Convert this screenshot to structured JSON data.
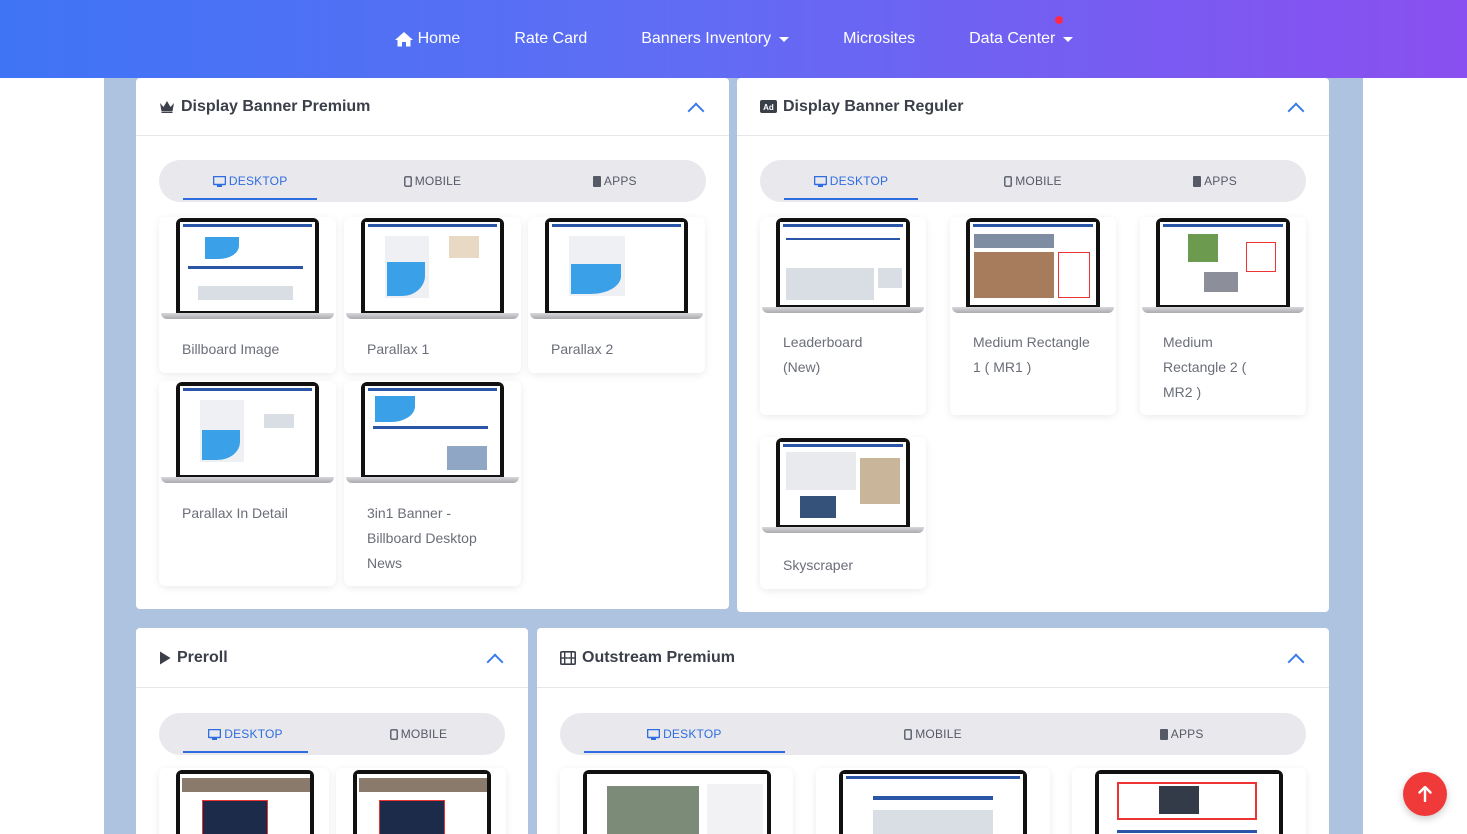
{
  "nav": {
    "home": "Home",
    "rate_card": "Rate Card",
    "banners_inventory": "Banners Inventory",
    "microsites": "Microsites",
    "data_center": "Data Center"
  },
  "tabs": {
    "desktop": "DESKTOP",
    "mobile": "MOBILE",
    "apps": "APPS"
  },
  "premium": {
    "title": "Display Banner Premium",
    "items": [
      "Billboard Image",
      "Parallax 1",
      "Parallax 2",
      "Parallax In Detail",
      "3in1 Banner - Billboard Desktop News"
    ]
  },
  "reguler": {
    "title": "Display Banner Reguler",
    "items": [
      "Leaderboard (New)",
      "Medium Rectangle 1 ( MR1 )",
      "Medium Rectangle 2 ( MR2 )",
      "Skyscraper"
    ]
  },
  "preroll": {
    "title": "Preroll"
  },
  "outstream": {
    "title": "Outstream Premium"
  },
  "colors": {
    "accent": "#2e6de0",
    "nav_start": "#3f74f5",
    "nav_end": "#8a4ff0",
    "fab": "#f03a3a"
  },
  "icons": [
    "home-icon",
    "crown-icon",
    "ad-icon",
    "play-icon",
    "film-icon",
    "desktop-icon",
    "mobile-icon",
    "tablet-icon",
    "arrow-up-icon"
  ]
}
